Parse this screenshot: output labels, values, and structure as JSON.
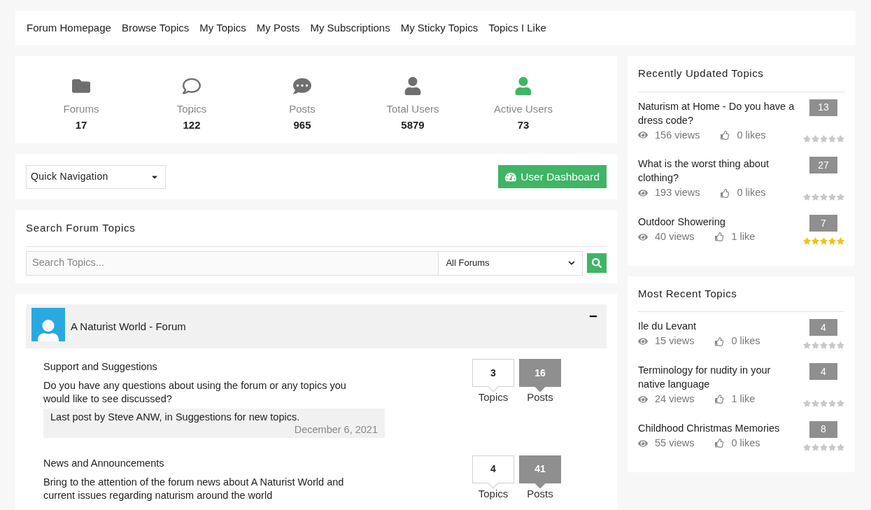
{
  "nav": [
    "Forum Homepage",
    "Browse Topics",
    "My Topics",
    "My Posts",
    "My Subscriptions",
    "My Sticky Topics",
    "Topics I Like"
  ],
  "stats": [
    {
      "kind": "folder",
      "label": "Forums",
      "value": "17",
      "color": "#6f6f6f"
    },
    {
      "kind": "comment",
      "label": "Topics",
      "value": "122",
      "color": "#6f6f6f"
    },
    {
      "kind": "comments",
      "label": "Posts",
      "value": "965",
      "color": "#6f6f6f"
    },
    {
      "kind": "user",
      "label": "Total Users",
      "value": "5879",
      "color": "#6f6f6f"
    },
    {
      "kind": "user",
      "label": "Active Users",
      "value": "73",
      "color": "#3fb565"
    }
  ],
  "quick_nav": {
    "value": "Quick Navigation"
  },
  "dashboard_button": "User Dashboard",
  "search": {
    "title": "Search Forum Topics",
    "placeholder": "Search Topics...",
    "scope": "All Forums"
  },
  "forum": {
    "title": "A Naturist World - Forum",
    "expanded": true,
    "subforums": [
      {
        "title": "Support and Suggestions",
        "description": "Do you have any questions about using the forum or any topics you would like to see discussed?",
        "topics": "3",
        "topics_label": "Topics",
        "posts": "16",
        "posts_label": "Posts",
        "last_post": "Last post by Steve ANW, in Suggestions for new topics.",
        "last_date": "December 6, 2021"
      },
      {
        "title": "News and Announcements",
        "description": "Bring to the attention of the forum news about A Naturist World and current issues regarding naturism around the world",
        "topics": "4",
        "topics_label": "Topics",
        "posts": "41",
        "posts_label": "Posts"
      }
    ]
  },
  "recently_updated": {
    "title": "Recently Updated Topics",
    "topics": [
      {
        "title": "Naturism at Home - Do you have a dress code?",
        "views": "156 views",
        "likes": "0 likes",
        "count": "13",
        "stars": 0
      },
      {
        "title": "What is the worst thing about clothing?",
        "views": "193 views",
        "likes": "0 likes",
        "count": "27",
        "stars": 0
      },
      {
        "title": "Outdoor Showering",
        "views": "40 views",
        "likes": "1 like",
        "count": "7",
        "stars": 5
      }
    ]
  },
  "most_recent": {
    "title": "Most Recent Topics",
    "topics": [
      {
        "title": "Ile du Levant",
        "views": "15 views",
        "likes": "0 likes",
        "count": "4",
        "stars": 0
      },
      {
        "title": "Terminology for nudity in your native language",
        "views": "24 views",
        "likes": "1 like",
        "count": "4",
        "stars": 0
      },
      {
        "title": "Childhood Christmas Memories",
        "views": "55 views",
        "likes": "0 likes",
        "count": "8",
        "stars": 0
      }
    ]
  }
}
